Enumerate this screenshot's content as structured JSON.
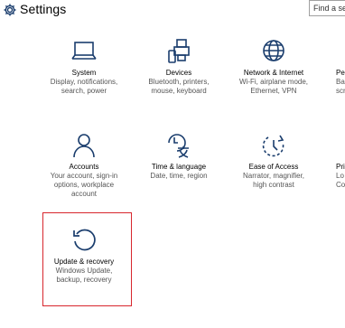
{
  "app": {
    "title": "Settings"
  },
  "search": {
    "placeholder": "Find a setting"
  },
  "tiles": [
    {
      "name": "System",
      "desc": [
        "Display, notifications,",
        "search, power"
      ],
      "icon": "laptop-icon"
    },
    {
      "name": "Devices",
      "desc": [
        "Bluetooth, printers,",
        "mouse, keyboard"
      ],
      "icon": "devices-icon"
    },
    {
      "name": "Network & Internet",
      "desc": [
        "Wi-Fi, airplane mode,",
        "Ethernet, VPN"
      ],
      "icon": "globe-icon"
    },
    {
      "name": "Accounts",
      "desc": [
        "Your account, sign-in",
        "options, workplace",
        "account"
      ],
      "icon": "person-icon"
    },
    {
      "name": "Time & language",
      "desc": [
        "Date, time, region"
      ],
      "icon": "time-language-icon"
    },
    {
      "name": "Ease of Access",
      "desc": [
        "Narrator, magnifier,",
        "high contrast"
      ],
      "icon": "ease-of-access-icon"
    },
    {
      "name": "Update & recovery",
      "desc": [
        "Windows Update,",
        "backup, recovery"
      ],
      "icon": "update-icon"
    }
  ],
  "clipped": {
    "row1": [
      "Pe",
      "Bac",
      "scr"
    ],
    "row2": [
      "Pri",
      "Lo",
      "Cor"
    ]
  },
  "colors": {
    "icon": "#1a3d6d",
    "highlight": "#d8262d"
  }
}
